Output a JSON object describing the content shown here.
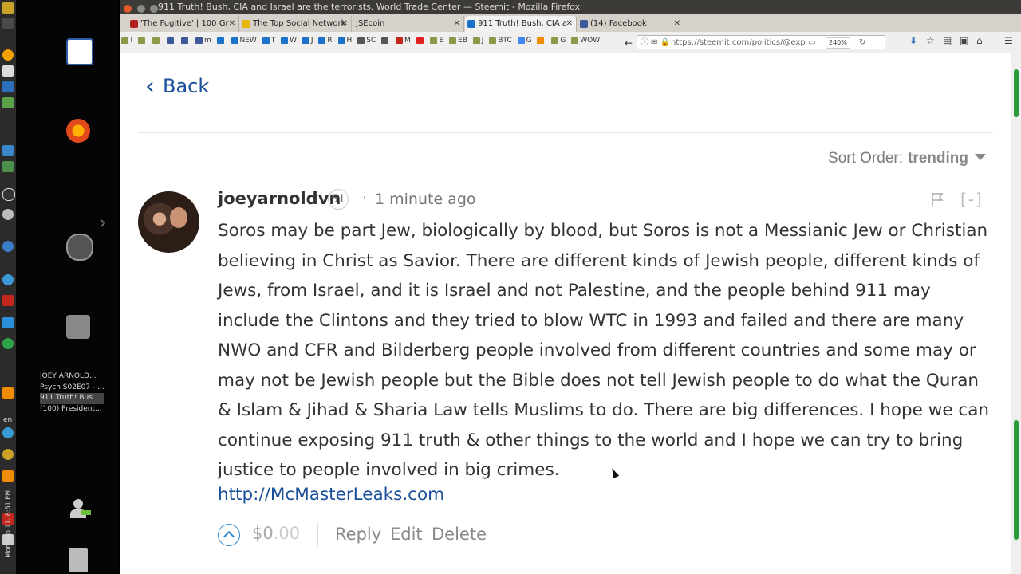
{
  "window": {
    "title": "911 Truth! Bush, CIA and Israel are the terrorists. World Trade Center — Steemit - Mozilla Firefox"
  },
  "tabs": [
    {
      "label": "'The Fugitive' | 100 Gr",
      "icon_color": "#b01e1e"
    },
    {
      "label": "The Top Social Network",
      "icon_color": "#e8b800"
    },
    {
      "label": "JSEcoin",
      "icon_color": ""
    },
    {
      "label": "911 Truth! Bush, CIA a",
      "icon_color": "#1a73c8"
    },
    {
      "label": "(14) Facebook",
      "icon_color": "#3b5998"
    }
  ],
  "bookmarks": [
    "!",
    "",
    "",
    "",
    "",
    "m",
    "",
    "NEW",
    "T",
    "W",
    "J",
    "R",
    "H",
    "SC",
    "",
    "M",
    "",
    "E",
    "EB",
    "J",
    "BTC",
    "G",
    "",
    "G",
    "WOW"
  ],
  "url": "https://steemit.com/politics/@exposethe",
  "zoom": "240%",
  "taskbar": {
    "windows": [
      "JOEY ARNOLD...",
      "Psych S02E07 - ...",
      "911 Truth! Bus...",
      "(100) President..."
    ],
    "keyboard_layout": "en",
    "clock": "Mon Sep 11, 8:51 PM"
  },
  "page": {
    "back_label": "Back",
    "sort_label": "Sort Order:",
    "sort_value": "trending",
    "comment": {
      "author": "joeyarnoldvn",
      "reputation": "51",
      "separator": "·",
      "time": "1 minute ago",
      "collapse": "[-]",
      "body": "Soros may be part Jew, biologically by blood, but Soros is not a Messianic Jew or Christian believing in Christ as Savior. There are different kinds of Jewish people, different kinds of Jews, from Israel, and it is Israel and not Palestine, and the people behind 911 may include the Clintons and they tried to blow WTC in 1993 and failed and there are many NWO and CFR and Bilderberg people involved from different countries and some may or may not be Jewish people but the Bible does not tell Jewish people to do what the Quran & Islam & Jihad & Sharia Law tells Muslims to do. There are big differences. I hope we can continue exposing 911 truth & other things to the world and I hope we can try to bring justice to people involved in big crimes.",
      "link": "http://McMasterLeaks.com",
      "payout_main": "$0",
      "payout_cents": ".00",
      "actions": [
        "Reply",
        "Edit",
        "Delete"
      ]
    }
  }
}
